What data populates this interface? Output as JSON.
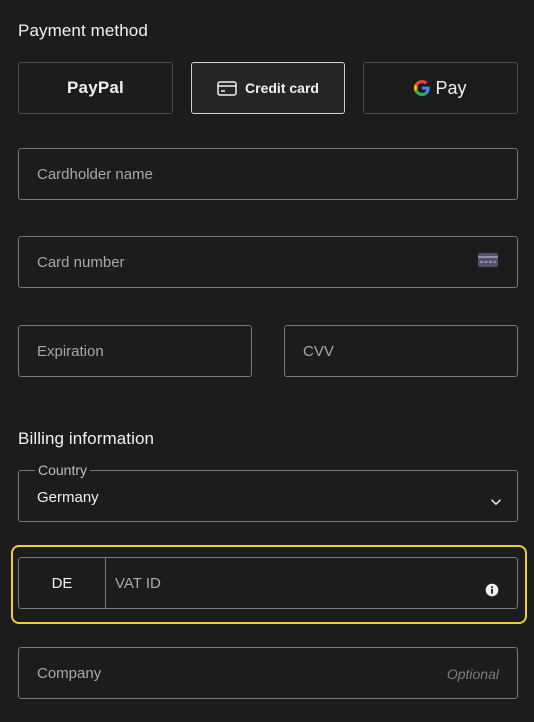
{
  "payment": {
    "title": "Payment method",
    "options": [
      {
        "label": "PayPal",
        "icon": "paypal-logo"
      },
      {
        "label": "Credit card",
        "icon": "credit-card-icon",
        "selected": true
      },
      {
        "label": "Pay",
        "icon": "google-g-logo"
      }
    ]
  },
  "card": {
    "cardholder_placeholder": "Cardholder name",
    "number_placeholder": "Card number",
    "expiration_placeholder": "Expiration",
    "cvv_placeholder": "CVV"
  },
  "billing": {
    "title": "Billing information",
    "country_label": "Country",
    "country_value": "Germany",
    "vat_prefix": "DE",
    "vat_placeholder": "VAT ID",
    "company_placeholder": "Company",
    "company_hint": "Optional"
  },
  "colors": {
    "background": "#1c1c1c",
    "focus_ring": "#f0cb3b",
    "border": "#7a7a7a"
  }
}
